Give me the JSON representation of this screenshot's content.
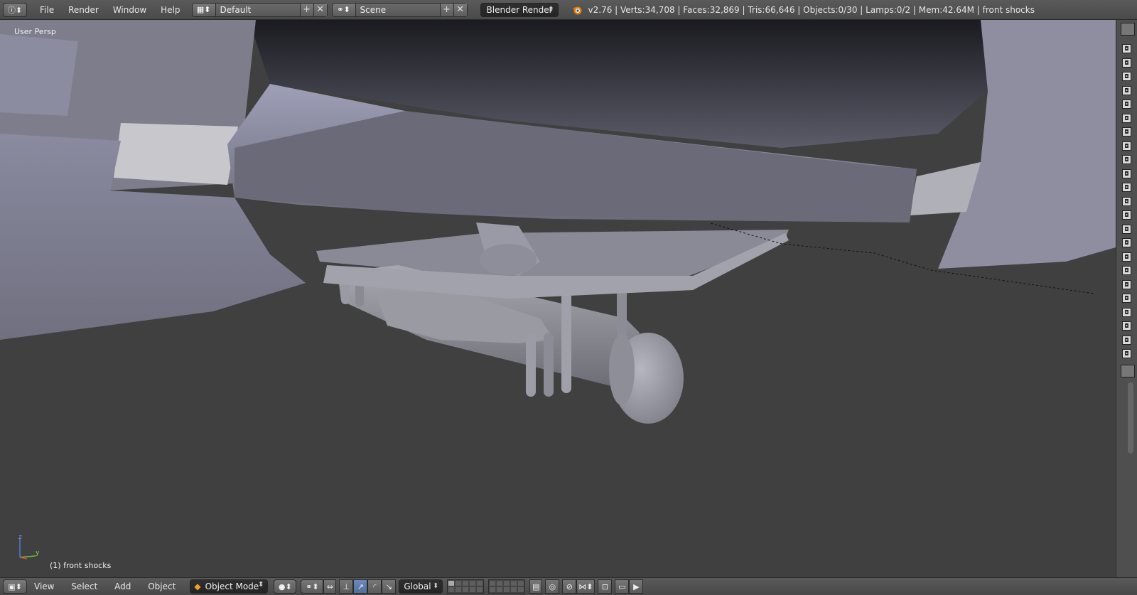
{
  "topbar": {
    "info_icon": "info-icon",
    "menus": [
      "File",
      "Render",
      "Window",
      "Help"
    ],
    "screen_layout": "Default",
    "scene": "Scene",
    "render_engine": "Blender Render",
    "stats": "v2.76 | Verts:34,708 | Faces:32,869 | Tris:66,646 | Objects:0/30 | Lamps:0/2 | Mem:42.64M | front shocks"
  },
  "viewport": {
    "view_label": "User Persp",
    "object_label": "(1) front shocks",
    "axis_z": "z",
    "axis_y": "y"
  },
  "bottombar": {
    "menus": [
      "View",
      "Select",
      "Add",
      "Object"
    ],
    "mode": "Object Mode",
    "orientation": "Global"
  },
  "colors": {
    "header": "#4f4f4f",
    "floor": "#3f3f3f",
    "model": "#8f8f9c",
    "accent": "#5680c2"
  }
}
